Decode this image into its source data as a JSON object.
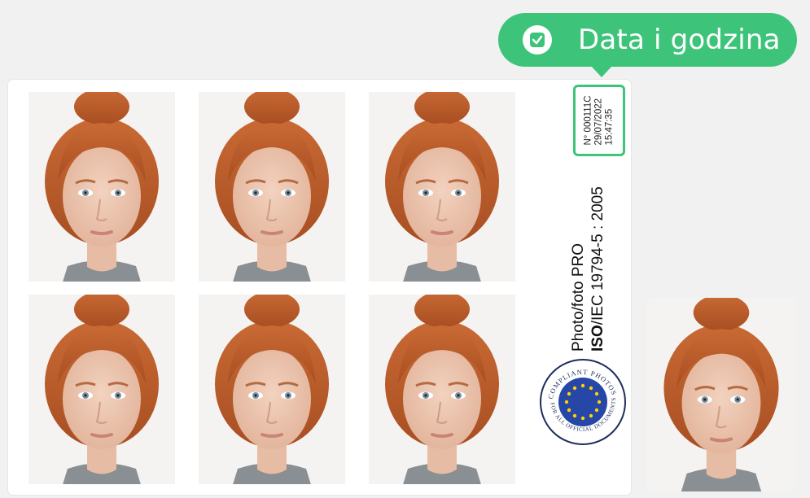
{
  "tooltip": {
    "label": "Data i godzina",
    "icon": "check-icon",
    "color": "#3ec47a"
  },
  "stamp": {
    "number": "N° 000111C",
    "date": "29/07/2022",
    "time": "15:47:35"
  },
  "brand": {
    "name": "Photo/foto PRO",
    "iso_prefix": "ISO",
    "iso_rest": "/IEC 19794-5 : 2005"
  },
  "badge": {
    "top_text": "COMPLIANT PHOTOS",
    "bottom_text": "FOR ALL OFFICIAL DOCUMENTS",
    "icon": "eu-stars-icon",
    "color": "#2646a8"
  },
  "photos": {
    "count": 6,
    "extra": 1
  }
}
